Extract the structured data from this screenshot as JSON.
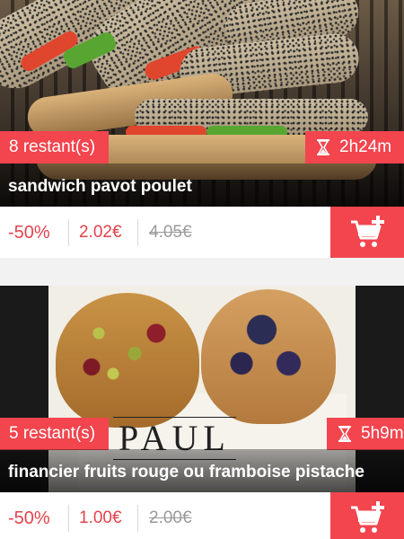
{
  "offers": [
    {
      "stock": "8 restant(s)",
      "time_left": "2h24m",
      "title": "sandwich pavot poulet",
      "discount": "-50%",
      "price": "2.02€",
      "old_price": "4.05€"
    },
    {
      "stock": "5 restant(s)",
      "time_left": "5h9m",
      "title": "financier fruits rouge ou framboise pistache",
      "discount": "-50%",
      "price": "1.00€",
      "old_price": "2.00€",
      "photo_logo": "PAUL"
    }
  ],
  "icons": {
    "hourglass": "hourglass-icon",
    "cart": "cart-plus-icon"
  },
  "colors": {
    "accent": "#f2454e",
    "price_text": "#e2434b",
    "old_price_text": "#9a9a9a"
  }
}
